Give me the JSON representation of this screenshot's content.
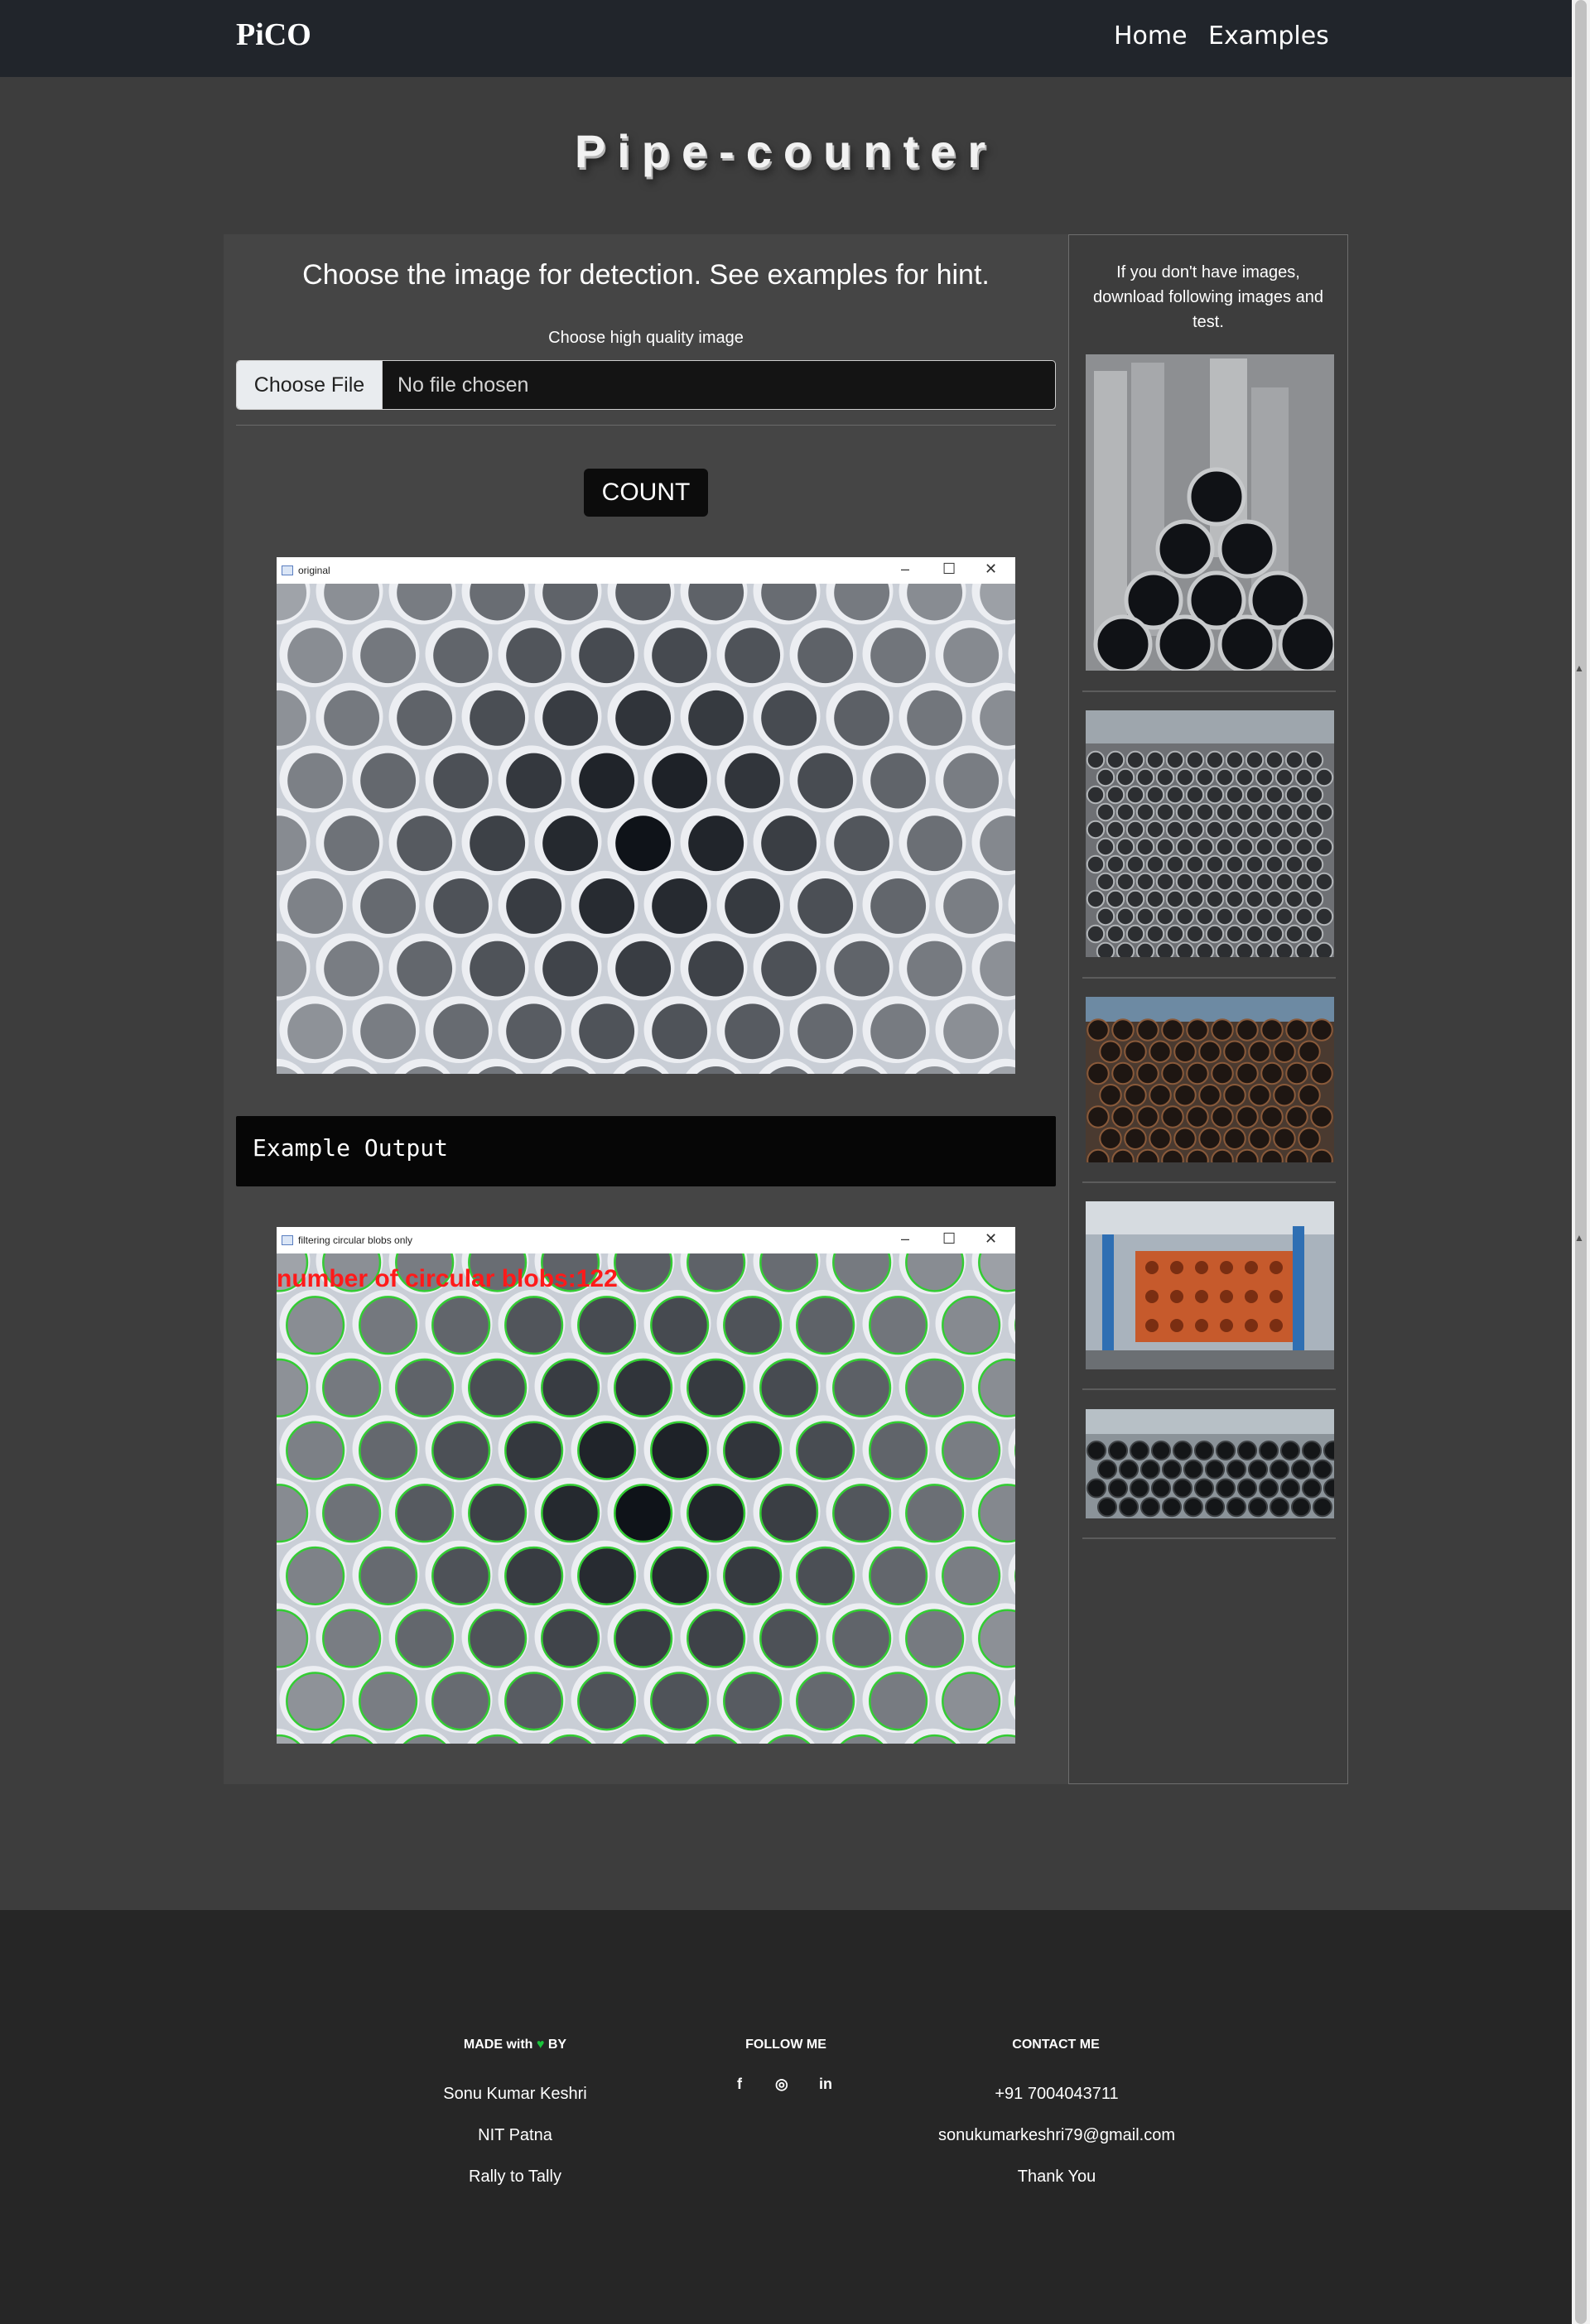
{
  "navbar": {
    "brand": "PiCO",
    "links": [
      "Home",
      "Examples"
    ]
  },
  "page_title": "Pipe-counter",
  "main": {
    "heading": "Choose the image for detection. See examples for hint.",
    "upload_label": "Choose high quality image",
    "file_button": "Choose File",
    "file_status": "No file chosen",
    "count_button": "COUNT",
    "original_window_title": "original",
    "output_heading": "Example Output",
    "filtered_window_title": "filtering circular blobs only",
    "blob_count_text": "number of circular blobs:122"
  },
  "sidebar": {
    "hint": "If you don't have images, download following images and test.",
    "thumbnails": [
      "pipe-pyramid-image",
      "pipe-stack-image",
      "rusty-pipes-image",
      "orange-pipe-rack-image",
      "black-pipes-image"
    ]
  },
  "footer": {
    "made_with": "MADE with",
    "by": "BY",
    "col1_lines": [
      "Sonu Kumar Keshri",
      "NIT Patna",
      "Rally to Tally"
    ],
    "follow_head": "FOLLOW ME",
    "social_icons": [
      "facebook-icon",
      "instagram-icon",
      "linkedin-icon"
    ],
    "contact_head": "CONTACT ME",
    "contact_lines": [
      "+91 7004043711",
      "sonukumarkeshri79@gmail.com",
      "Thank You"
    ]
  },
  "colors": {
    "navbar_bg": "#21252b",
    "page_bg": "#3d3d3d",
    "panel_bg": "#454545",
    "footer_bg": "#262626",
    "blob_text": "#ff1a1a",
    "circle_stroke": "#33cc33",
    "heart": "#19c43b"
  }
}
